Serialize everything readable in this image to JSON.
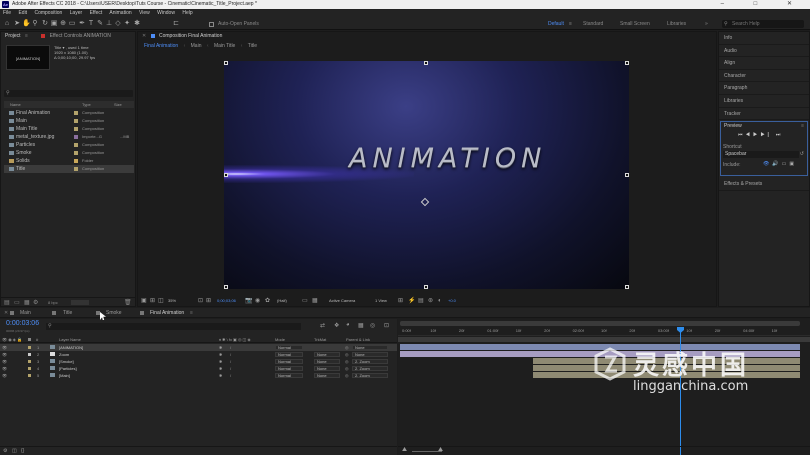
{
  "titlebar": {
    "app_icon": "Ae",
    "title": "Adobe After Effects CC 2018 - C:\\Users\\USER\\Desktop\\Tuts Course - Cinematic\\Cinematic_Title_Project.aep *",
    "win_buttons": "– □ ✕"
  },
  "menu": [
    "File",
    "Edit",
    "Composition",
    "Layer",
    "Effect",
    "Animation",
    "View",
    "Window",
    "Help"
  ],
  "toolbar": {
    "auto_open_panels": "Auto-Open Panels",
    "workspaces": [
      "Default",
      "≡",
      "Standard",
      "Small Screen",
      "Libraries",
      "»"
    ],
    "search_placeholder": "Search Help"
  },
  "project_panel": {
    "tab_project": "Project",
    "tab_effects": "Effect Controls ANIMATION",
    "thumb_text": "[ANIMATION]",
    "info_name": "Title ▾ , used 1 time",
    "info_size": "1920 x 1080 (1.00)",
    "info_duration": "Δ 0;00;10;00, 29.97 fps",
    "search_icon": "search-icon",
    "headers": {
      "name": "Name",
      "type": "Type",
      "size": "Size"
    },
    "items": [
      {
        "name": "Final Animation",
        "type": "Composition",
        "size": "",
        "icon": "composition-icon",
        "label_color": "#b3a36b"
      },
      {
        "name": "Main",
        "type": "Composition",
        "size": "",
        "icon": "composition-icon",
        "label_color": "#b3a36b"
      },
      {
        "name": "Main Title",
        "type": "Composition",
        "size": "",
        "icon": "composition-icon",
        "label_color": "#b3a36b"
      },
      {
        "name": "metal_texture.jpg",
        "type": "Importe...G",
        "size": "...MB",
        "icon": "image-icon",
        "label_color": "#8b6f9e"
      },
      {
        "name": "Particles",
        "type": "Composition",
        "size": "",
        "icon": "composition-icon",
        "label_color": "#b3a36b"
      },
      {
        "name": "Smoke",
        "type": "Composition",
        "size": "",
        "icon": "composition-icon",
        "label_color": "#b3a36b"
      },
      {
        "name": "Solids",
        "type": "Folder",
        "size": "",
        "icon": "folder-icon",
        "label_color": "#c9a85a"
      },
      {
        "name": "Title",
        "type": "Composition",
        "size": "",
        "icon": "composition-icon",
        "label_color": "#b3a36b"
      }
    ],
    "bpc": "8 bpc"
  },
  "composition_panel": {
    "tab_title": "Composition Final Animation",
    "breadcrumbs": [
      "Final Animation",
      "Main",
      "Main Title",
      "Title"
    ],
    "canvas_text": "ANIMATION",
    "footer": {
      "zoom": "35%",
      "timecode": "0;00;03;06",
      "resolution": "(Half)",
      "camera": "Active Camera",
      "view": "1 View",
      "exposure": "+0.0"
    }
  },
  "right_panel": {
    "items": [
      "Info",
      "Audio",
      "Align",
      "Character",
      "Paragraph",
      "Libraries",
      "Tracker"
    ],
    "preview": {
      "title": "Preview",
      "shortcut_label": "Shortcut",
      "shortcut_value": "Spacebar",
      "include_label": "Include:"
    },
    "effects": "Effects & Presets"
  },
  "timeline": {
    "tabs": [
      "Main",
      "Title",
      "Smoke",
      "Final Animation"
    ],
    "timecode": "0:00:03:06",
    "frames": "00096 (29.97 fps)",
    "headers": {
      "layer": "Layer Name",
      "mode": "Mode",
      "trkmat": "TrkMat",
      "parent": "Parent & Link"
    },
    "layers": [
      {
        "num": "1",
        "name": "[ANIMATION]",
        "mode": "Normal",
        "trkmat": "",
        "parent": "None",
        "label_color": "#b3a36b"
      },
      {
        "num": "2",
        "name": "Zoom",
        "mode": "Normal",
        "trkmat": "None",
        "parent": "None",
        "label_color": "#c9c9c9"
      },
      {
        "num": "3",
        "name": "[Smoke]",
        "mode": "Normal",
        "trkmat": "None",
        "parent": "2. Zoom",
        "label_color": "#b3a36b"
      },
      {
        "num": "4",
        "name": "[Particles]",
        "mode": "Normal",
        "trkmat": "None",
        "parent": "2. Zoom",
        "label_color": "#b3a36b"
      },
      {
        "num": "5",
        "name": "[Main]",
        "mode": "Normal",
        "trkmat": "None",
        "parent": "2. Zoom",
        "label_color": "#b3a36b"
      }
    ],
    "ruler": [
      "0:00f",
      "10f",
      "20f",
      "01:00f",
      "10f",
      "20f",
      "02:00f",
      "10f",
      "20f",
      "03:00f",
      "10f",
      "20f",
      "04:00f",
      "10f"
    ],
    "toggle_label": "Toggle Switches / Modes"
  },
  "watermark": {
    "cn": "灵感中国",
    "url": "lingganchina.com"
  },
  "colors": {
    "accent": "#4e8ef7",
    "playhead": "#2d8ceb",
    "layer_bar_light": "#7d8ab2",
    "layer_bar_tan": "#8f8a73",
    "layer_bar_lilac": "#a69cc1"
  }
}
